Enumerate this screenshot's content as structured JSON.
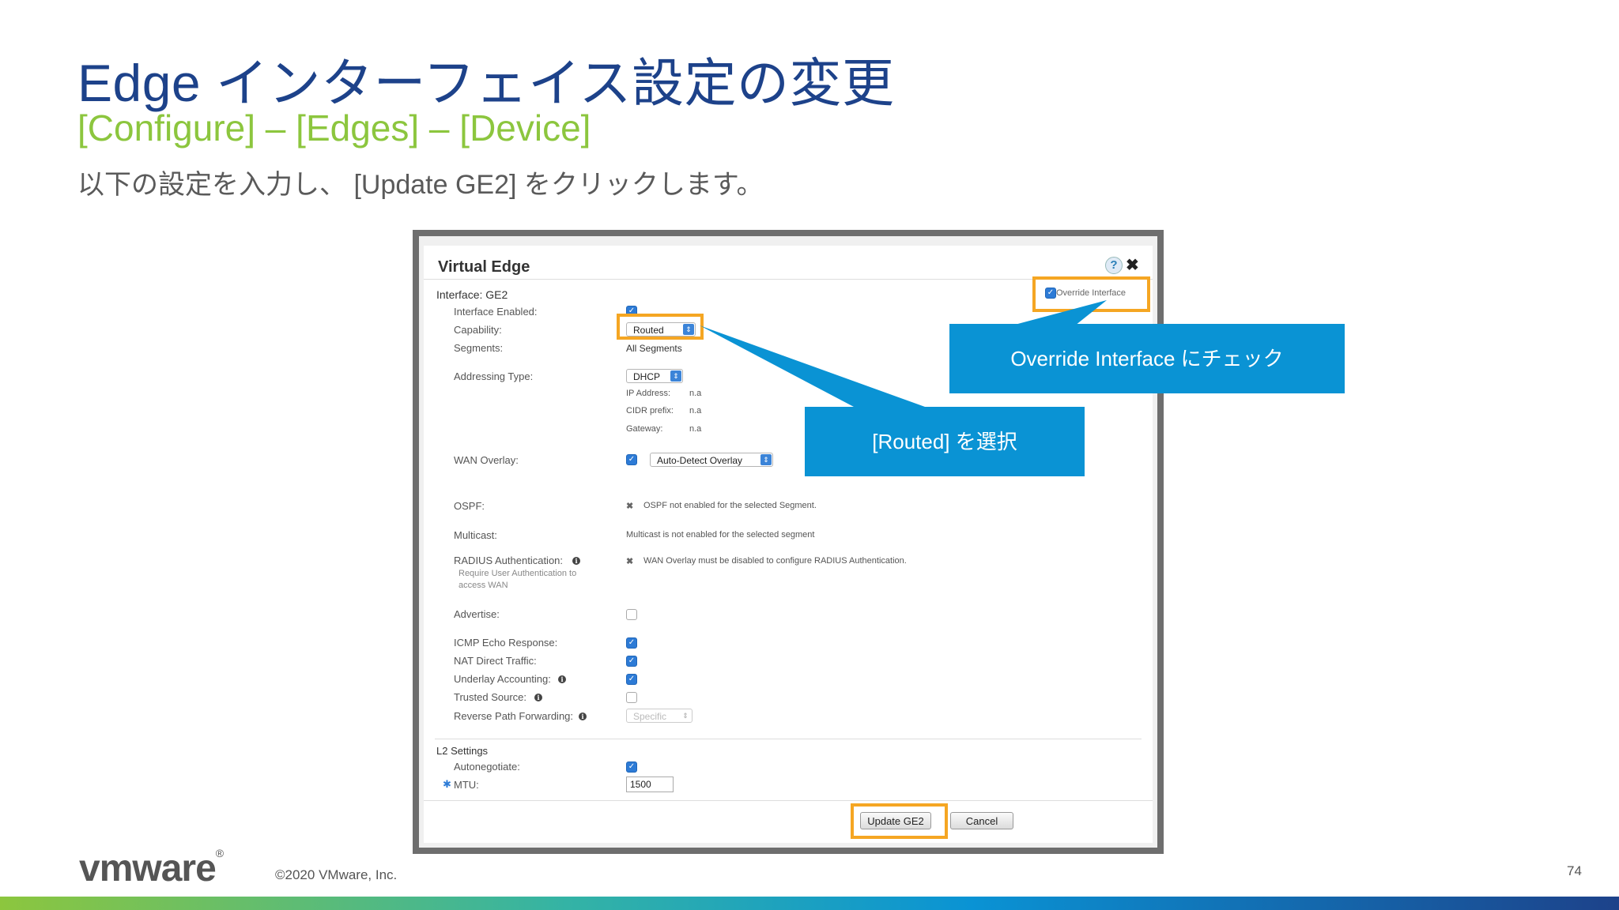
{
  "slide": {
    "title": "Edge インターフェイス設定の変更",
    "subtitle": "[Configure] – [Edges] – [Device]",
    "instruction": "以下の設定を入力し、 [Update GE2] をクリックします。",
    "page_number": "74",
    "copyright": "©2020 VMware, Inc.",
    "logo": "vmware"
  },
  "dialog": {
    "title": "Virtual Edge",
    "help_icon": "?",
    "close_icon": "✖",
    "interface_header": "Interface: GE2",
    "override_label": "Override Interface",
    "override_checked": true,
    "fields": {
      "interface_enabled": {
        "label": "Interface Enabled:",
        "checked": true
      },
      "capability": {
        "label": "Capability:",
        "value": "Routed"
      },
      "segments": {
        "label": "Segments:",
        "value": "All Segments"
      },
      "addressing_type": {
        "label": "Addressing Type:",
        "value": "DHCP"
      },
      "ip_address": {
        "label": "IP Address:",
        "value": "n.a"
      },
      "cidr_prefix": {
        "label": "CIDR prefix:",
        "value": "n.a"
      },
      "gateway": {
        "label": "Gateway:",
        "value": "n.a"
      },
      "wan_overlay": {
        "label": "WAN Overlay:",
        "checked": true,
        "value": "Auto-Detect Overlay"
      },
      "ospf": {
        "label": "OSPF:",
        "note": "OSPF not enabled for the selected Segment."
      },
      "multicast": {
        "label": "Multicast:",
        "note": "Multicast is not enabled for the selected segment"
      },
      "radius": {
        "label": "RADIUS Authentication:",
        "sub1": "Require User Authentication to",
        "sub2": "access WAN",
        "note": "WAN Overlay must be disabled to configure RADIUS Authentication."
      },
      "advertise": {
        "label": "Advertise:",
        "checked": false
      },
      "icmp": {
        "label": "ICMP Echo Response:",
        "checked": true
      },
      "nat_direct": {
        "label": "NAT Direct Traffic:",
        "checked": true
      },
      "underlay": {
        "label": "Underlay Accounting:",
        "checked": true
      },
      "trusted_source": {
        "label": "Trusted Source:",
        "checked": false
      },
      "rpf": {
        "label": "Reverse Path Forwarding:",
        "value": "Specific"
      }
    },
    "l2": {
      "header": "L2 Settings",
      "autonegotiate": {
        "label": "Autonegotiate:",
        "checked": true
      },
      "mtu": {
        "label": "MTU:",
        "required_mark": "✱",
        "value": "1500"
      }
    },
    "buttons": {
      "update": "Update GE2",
      "cancel": "Cancel"
    }
  },
  "callouts": {
    "override": "Override Interface にチェック",
    "routed": "[Routed] を選択"
  },
  "colors": {
    "title": "#1d428a",
    "subtitle": "#8cc63e",
    "callout": "#0a93d4",
    "highlight": "#f5a623"
  }
}
